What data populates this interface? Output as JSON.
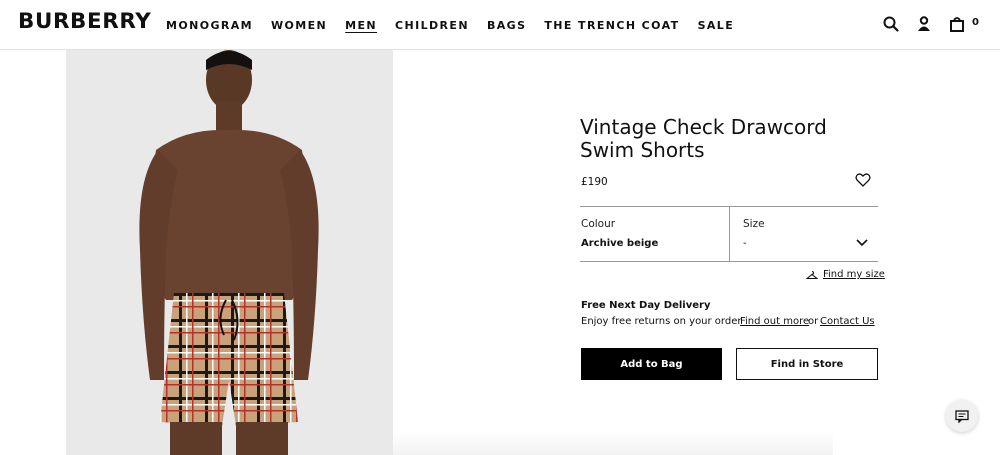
{
  "header": {
    "logo": "BURBERRY",
    "nav": [
      {
        "label": "MONOGRAM",
        "active": false
      },
      {
        "label": "WOMEN",
        "active": false
      },
      {
        "label": "MEN",
        "active": true
      },
      {
        "label": "CHILDREN",
        "active": false
      },
      {
        "label": "BAGS",
        "active": false
      },
      {
        "label": "THE TRENCH COAT",
        "active": false
      },
      {
        "label": "SALE",
        "active": false
      }
    ],
    "icons": [
      "search-icon",
      "account-icon",
      "bag-icon"
    ],
    "bag_count": "0"
  },
  "product": {
    "title": "Vintage Check Drawcord Swim Shorts",
    "price": "£190",
    "colour_label": "Colour",
    "colour_value": "Archive beige",
    "size_label": "Size",
    "size_value": "-",
    "find_size": "Find my size",
    "delivery_title": "Free Next Day Delivery",
    "delivery_sub": "Enjoy free returns on your order",
    "find_out_more": "Find out more",
    "or": "or",
    "contact_us": "Contact Us",
    "add_to_bag": "Add to Bag",
    "find_in_store": "Find in Store"
  },
  "colors": {
    "accent": "#000000",
    "check_beige": "#c9a27a",
    "check_red": "#b3322c"
  }
}
